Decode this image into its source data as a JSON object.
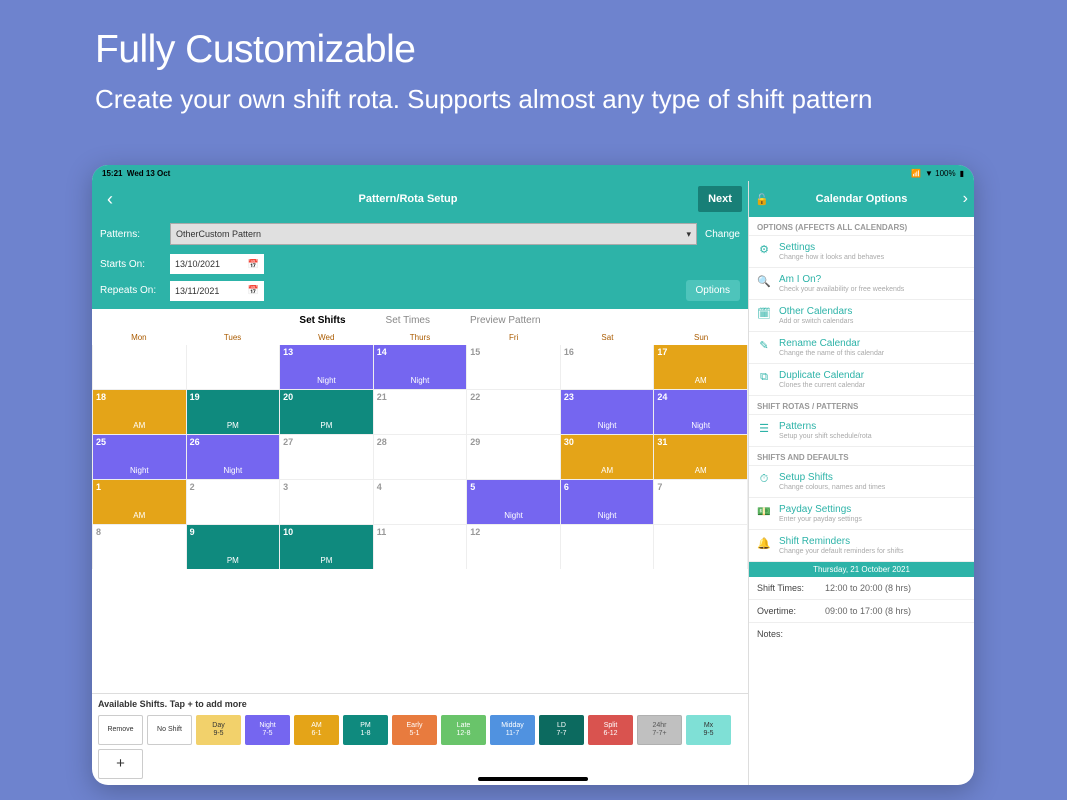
{
  "promo": {
    "title": "Fully Customizable",
    "subtitle": "Create your own shift rota. Supports almost any type of shift pattern"
  },
  "status": {
    "time": "15:21",
    "date": "Wed 13 Oct",
    "battery": "▼ 100%"
  },
  "header": {
    "title": "Pattern/Rota Setup",
    "next": "Next",
    "options_title": "Calendar Options"
  },
  "patterns": {
    "label": "Patterns:",
    "selected": "OtherCustom Pattern",
    "change": "Change"
  },
  "starts": {
    "label": "Starts On:",
    "value": "13/10/2021"
  },
  "repeats": {
    "label": "Repeats On:",
    "value": "13/11/2021"
  },
  "options_btn": "Options",
  "tabs": [
    "Set Shifts",
    "Set Times",
    "Preview Pattern"
  ],
  "days": [
    "Mon",
    "Tues",
    "Wed",
    "Thurs",
    "Fri",
    "Sat",
    "Sun"
  ],
  "cells": [
    {
      "n": "",
      "l": "",
      "c": "empty"
    },
    {
      "n": "",
      "l": "",
      "c": "empty"
    },
    {
      "n": "13",
      "l": "Night",
      "c": "night"
    },
    {
      "n": "14",
      "l": "Night",
      "c": "night"
    },
    {
      "n": "15",
      "l": "",
      "c": "wht"
    },
    {
      "n": "16",
      "l": "",
      "c": "wht"
    },
    {
      "n": "17",
      "l": "AM",
      "c": "am"
    },
    {
      "n": "18",
      "l": "AM",
      "c": "am"
    },
    {
      "n": "19",
      "l": "PM",
      "c": "pm"
    },
    {
      "n": "20",
      "l": "PM",
      "c": "pm"
    },
    {
      "n": "21",
      "l": "",
      "c": "wht"
    },
    {
      "n": "22",
      "l": "",
      "c": "wht"
    },
    {
      "n": "23",
      "l": "Night",
      "c": "night"
    },
    {
      "n": "24",
      "l": "Night",
      "c": "night"
    },
    {
      "n": "25",
      "l": "Night",
      "c": "night"
    },
    {
      "n": "26",
      "l": "Night",
      "c": "night"
    },
    {
      "n": "27",
      "l": "",
      "c": "wht"
    },
    {
      "n": "28",
      "l": "",
      "c": "wht"
    },
    {
      "n": "29",
      "l": "",
      "c": "wht"
    },
    {
      "n": "30",
      "l": "AM",
      "c": "am"
    },
    {
      "n": "31",
      "l": "AM",
      "c": "am"
    },
    {
      "n": "1",
      "l": "AM",
      "c": "am"
    },
    {
      "n": "2",
      "l": "",
      "c": "wht"
    },
    {
      "n": "3",
      "l": "",
      "c": "wht"
    },
    {
      "n": "4",
      "l": "",
      "c": "wht"
    },
    {
      "n": "5",
      "l": "Night",
      "c": "night"
    },
    {
      "n": "6",
      "l": "Night",
      "c": "night"
    },
    {
      "n": "7",
      "l": "",
      "c": "wht"
    },
    {
      "n": "8",
      "l": "",
      "c": "wht"
    },
    {
      "n": "9",
      "l": "PM",
      "c": "pm"
    },
    {
      "n": "10",
      "l": "PM",
      "c": "pm"
    },
    {
      "n": "11",
      "l": "",
      "c": "wht"
    },
    {
      "n": "12",
      "l": "",
      "c": "wht"
    },
    {
      "n": "",
      "l": "",
      "c": "empty"
    },
    {
      "n": "",
      "l": "",
      "c": "empty"
    }
  ],
  "avail_title": "Available Shifts. Tap + to add more",
  "chips": [
    {
      "t": "Remove",
      "s": "",
      "c": ""
    },
    {
      "t": "No Shift",
      "s": "",
      "c": ""
    },
    {
      "t": "Day",
      "s": "9-5",
      "c": "chip-y"
    },
    {
      "t": "Night",
      "s": "7-5",
      "c": "chip-ni"
    },
    {
      "t": "AM",
      "s": "6-1",
      "c": "chip-am"
    },
    {
      "t": "PM",
      "s": "1-8",
      "c": "chip-pm"
    },
    {
      "t": "Early",
      "s": "5-1",
      "c": "chip-or"
    },
    {
      "t": "Late",
      "s": "12-8",
      "c": "chip-gr"
    },
    {
      "t": "Midday",
      "s": "11-7",
      "c": "chip-bl"
    },
    {
      "t": "LD",
      "s": "7-7",
      "c": "chip-dk"
    },
    {
      "t": "Split",
      "s": "6-12",
      "c": "chip-rd"
    },
    {
      "t": "24hr",
      "s": "7-7+",
      "c": "chip-gy"
    },
    {
      "t": "Mx",
      "s": "9-5",
      "c": "chip-cy"
    },
    {
      "t": "+",
      "s": "",
      "c": "chip-plus"
    }
  ],
  "opts": {
    "s1": "OPTIONS (AFFECTS ALL CALENDARS)",
    "items1": [
      {
        "i": "gear",
        "t": "Settings",
        "d": "Change how it looks and behaves"
      },
      {
        "i": "search",
        "t": "Am I On?",
        "d": "Check your availability or free weekends"
      },
      {
        "i": "cal",
        "t": "Other Calendars",
        "d": "Add or switch calendars"
      },
      {
        "i": "pencil",
        "t": "Rename Calendar",
        "d": "Change the name of this calendar"
      },
      {
        "i": "copy",
        "t": "Duplicate Calendar",
        "d": "Clones the current calendar"
      }
    ],
    "s2": "SHIFT ROTAS / PATTERNS",
    "items2": [
      {
        "i": "list",
        "t": "Patterns",
        "d": "Setup your shift schedule/rota"
      }
    ],
    "s3": "SHIFTS AND DEFAULTS",
    "items3": [
      {
        "i": "clock",
        "t": "Setup Shifts",
        "d": "Change colours, names and times"
      },
      {
        "i": "money",
        "t": "Payday Settings",
        "d": "Enter your payday settings"
      },
      {
        "i": "bell",
        "t": "Shift Reminders",
        "d": "Change your default reminders for shifts"
      }
    ]
  },
  "event": {
    "date": "Thursday, 21 October 2021",
    "shift_k": "Shift Times:",
    "shift_v": "12:00 to 20:00 (8 hrs)",
    "ot_k": "Overtime:",
    "ot_v": "09:00 to 17:00 (8 hrs)",
    "notes_k": "Notes:"
  }
}
